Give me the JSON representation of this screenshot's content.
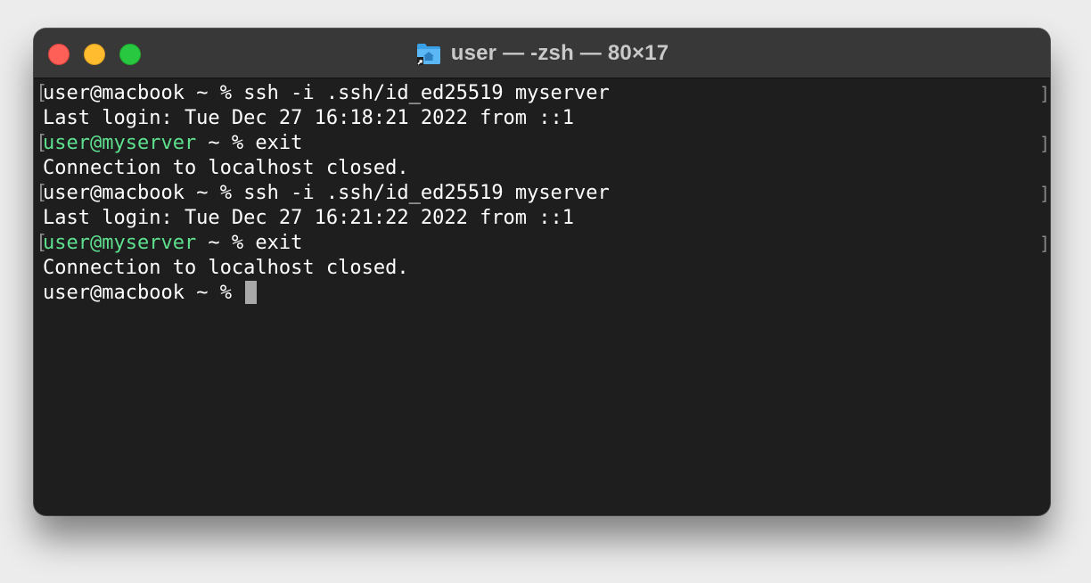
{
  "window": {
    "title": "user — -zsh — 80×17",
    "title_icon": "home-folder-icon",
    "controls": {
      "close": "close-button",
      "minimize": "minimize-button",
      "zoom": "zoom-button"
    }
  },
  "colors": {
    "background": "#1e1e1e",
    "titlebar": "#383838",
    "text": "#ffffff",
    "remote_user": "#5ee08f",
    "close": "#fe5f57",
    "minimize": "#febc2e",
    "zoom": "#28c840",
    "cursor": "#a8a8a8"
  },
  "terminal": {
    "lines": [
      {
        "prompt": "user@macbook",
        "suffix": " ~ % ",
        "command": "ssh -i .ssh/id_ed25519 myserver",
        "marked": true,
        "remote": false
      },
      {
        "text": "Last login: Tue Dec 27 16:18:21 2022 from ::1"
      },
      {
        "prompt": "user@myserver",
        "suffix": " ~ % ",
        "command": "exit",
        "marked": true,
        "remote": true
      },
      {
        "text": "Connection to localhost closed."
      },
      {
        "prompt": "user@macbook",
        "suffix": " ~ % ",
        "command": "ssh -i .ssh/id_ed25519 myserver",
        "marked": true,
        "remote": false
      },
      {
        "text": "Last login: Tue Dec 27 16:21:22 2022 from ::1"
      },
      {
        "prompt": "user@myserver",
        "suffix": " ~ % ",
        "command": "exit",
        "marked": true,
        "remote": true
      },
      {
        "text": "Connection to localhost closed."
      },
      {
        "prompt": "user@macbook",
        "suffix": " ~ % ",
        "command": "",
        "marked": false,
        "remote": false,
        "cursor": true
      }
    ]
  }
}
